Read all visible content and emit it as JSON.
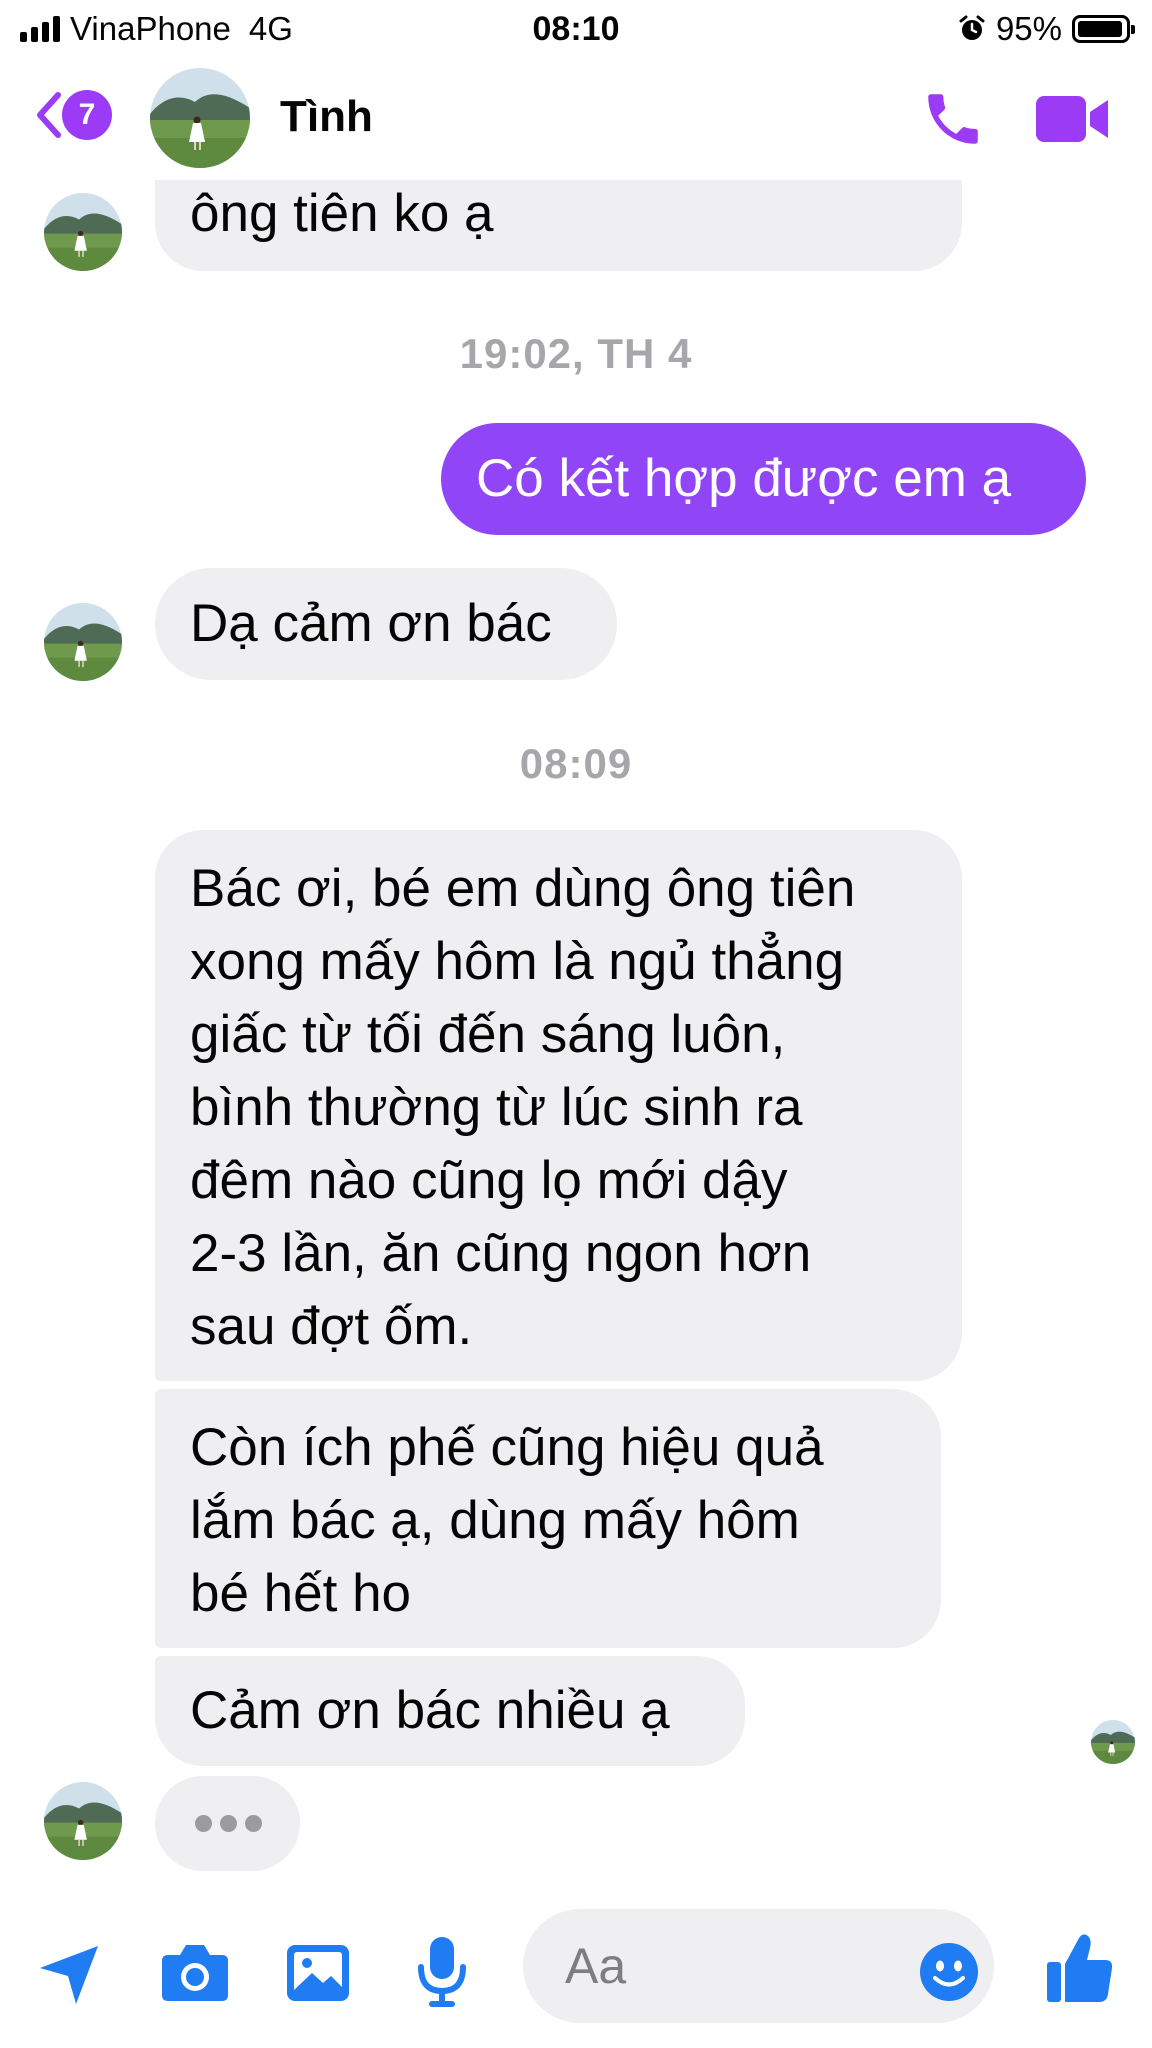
{
  "status_bar": {
    "carrier": "VinaPhone",
    "network": "4G",
    "time": "08:10",
    "battery": "95%",
    "battery_level": 0.95,
    "icons": [
      "signal-bars-icon",
      "alarm-icon",
      "battery-icon"
    ]
  },
  "header": {
    "unread_count": "7",
    "contact_name": "Tình",
    "icons": [
      "back-chevron-icon",
      "phone-icon",
      "video-camera-icon"
    ],
    "accent_color": "#9b3bf5"
  },
  "conversation": {
    "messages": [
      {
        "id": "m1",
        "sender": "contact",
        "lines": [
          "ông tiên ko ạ"
        ]
      },
      {
        "id": "stamp1",
        "timestamp": "19:02, TH 4"
      },
      {
        "id": "m2",
        "sender": "me",
        "lines": [
          "Có kết hợp được em ạ"
        ]
      },
      {
        "id": "m3",
        "sender": "contact",
        "lines": [
          "Dạ cảm ơn bác"
        ]
      },
      {
        "id": "stamp2",
        "timestamp": "08:09"
      },
      {
        "id": "m4",
        "sender": "contact",
        "lines": [
          "Bác ơi, bé em dùng ông tiên",
          "xong mấy hôm là ngủ thẳng",
          "giấc từ tối đến sáng luôn,",
          "bình thường từ lúc sinh ra",
          "đêm nào cũng lọ mới dậy",
          "2-3 lần, ăn cũng ngon hơn",
          "sau đợt ốm."
        ]
      },
      {
        "id": "m5",
        "sender": "contact",
        "lines": [
          "Còn ích phế cũng hiệu quả",
          "lắm bác ạ, dùng mấy hôm",
          "bé hết ho"
        ]
      },
      {
        "id": "m6",
        "sender": "contact",
        "lines": [
          "Cảm ơn bác nhiều ạ"
        ]
      }
    ],
    "typing_indicator": true,
    "sent_bubble_color": "#9045f7",
    "received_bubble_color": "#efeff1"
  },
  "composer": {
    "placeholder": "Aa",
    "icons": [
      "location-arrow-icon",
      "camera-icon",
      "image-icon",
      "microphone-icon",
      "emoji-icon",
      "thumbs-up-icon"
    ],
    "icon_color": "#1f7cf2"
  }
}
